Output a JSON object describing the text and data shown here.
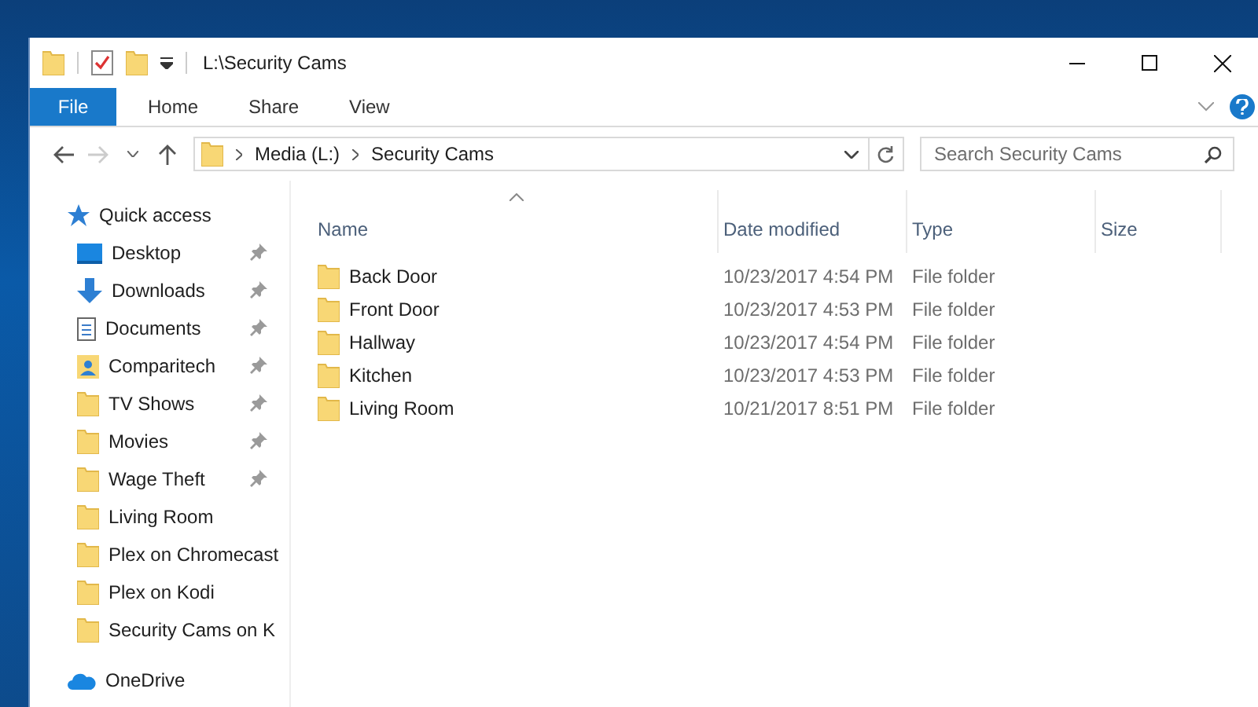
{
  "window": {
    "title": "L:\\Security Cams"
  },
  "ribbon": {
    "file_tab": "File",
    "tabs": [
      {
        "label": "Home"
      },
      {
        "label": "Share"
      },
      {
        "label": "View"
      }
    ]
  },
  "navigation": {
    "back_disabled": false,
    "forward_disabled": true
  },
  "address_bar": {
    "crumbs": [
      "Media (L:)",
      "Security Cams"
    ]
  },
  "search": {
    "placeholder": "Search Security Cams"
  },
  "sidebar": {
    "items": [
      {
        "label": "Quick access",
        "kind": "star",
        "pinned": false,
        "children": [
          {
            "label": "Desktop",
            "kind": "desktop",
            "pinned": true
          },
          {
            "label": "Downloads",
            "kind": "download",
            "pinned": true
          },
          {
            "label": "Documents",
            "kind": "document",
            "pinned": true
          },
          {
            "label": "Comparitech",
            "kind": "user",
            "pinned": true
          },
          {
            "label": "TV Shows",
            "kind": "folder",
            "pinned": true
          },
          {
            "label": "Movies",
            "kind": "folder",
            "pinned": true
          },
          {
            "label": "Wage Theft",
            "kind": "folder",
            "pinned": true
          },
          {
            "label": "Living Room",
            "kind": "folder",
            "pinned": false
          },
          {
            "label": "Plex on Chromecast",
            "kind": "folder",
            "pinned": false
          },
          {
            "label": "Plex on Kodi",
            "kind": "folder",
            "pinned": false
          },
          {
            "label": "Security Cams on K",
            "kind": "folder",
            "pinned": false
          }
        ]
      },
      {
        "label": "OneDrive",
        "kind": "cloud",
        "pinned": false
      }
    ]
  },
  "table": {
    "columns": [
      {
        "label": "Name",
        "sorted": true
      },
      {
        "label": "Date modified",
        "sorted": false
      },
      {
        "label": "Type",
        "sorted": false
      },
      {
        "label": "Size",
        "sorted": false
      }
    ],
    "rows": [
      {
        "name": "Back Door",
        "date": "10/23/2017 4:54 PM",
        "type": "File folder"
      },
      {
        "name": "Front Door",
        "date": "10/23/2017 4:53 PM",
        "type": "File folder"
      },
      {
        "name": "Hallway",
        "date": "10/23/2017 4:54 PM",
        "type": "File folder"
      },
      {
        "name": "Kitchen",
        "date": "10/23/2017 4:53 PM",
        "type": "File folder"
      },
      {
        "name": "Living Room",
        "date": "10/21/2017 8:51 PM",
        "type": "File folder"
      }
    ]
  }
}
